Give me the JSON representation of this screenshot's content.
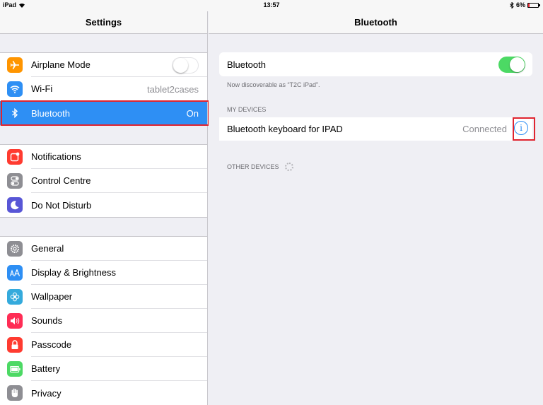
{
  "status_bar": {
    "device": "iPad",
    "time": "13:57",
    "battery": "6%"
  },
  "master": {
    "title": "Settings",
    "groups": [
      [
        {
          "label": "Airplane Mode",
          "icon": "airplane-icon",
          "color": "#ff9500"
        },
        {
          "label": "Wi-Fi",
          "value": "tablet2cases",
          "icon": "wifi-icon",
          "color": "#2e8ff4"
        },
        {
          "label": "Bluetooth",
          "value": "On",
          "icon": "bluetooth-icon",
          "color": "#2e8ff4"
        }
      ],
      [
        {
          "label": "Notifications",
          "icon": "notifications-icon",
          "color": "#ff3b30"
        },
        {
          "label": "Control Centre",
          "icon": "control-centre-icon",
          "color": "#8e8e93"
        },
        {
          "label": "Do Not Disturb",
          "icon": "moon-icon",
          "color": "#5856d6"
        }
      ],
      [
        {
          "label": "General",
          "icon": "gear-icon",
          "color": "#8e8e93"
        },
        {
          "label": "Display & Brightness",
          "icon": "text-size-icon",
          "color": "#2e8ff4"
        },
        {
          "label": "Wallpaper",
          "icon": "flower-icon",
          "color": "#34aadc"
        },
        {
          "label": "Sounds",
          "icon": "speaker-icon",
          "color": "#ff2d55"
        },
        {
          "label": "Passcode",
          "icon": "lock-icon",
          "color": "#ff3b30"
        },
        {
          "label": "Battery",
          "icon": "battery-icon",
          "color": "#4cd964"
        },
        {
          "label": "Privacy",
          "icon": "hand-icon",
          "color": "#8e8e93"
        }
      ]
    ]
  },
  "detail": {
    "title": "Bluetooth",
    "bluetooth_label": "Bluetooth",
    "discoverable": "Now discoverable as “T2C iPad”.",
    "my_devices_header": "MY DEVICES",
    "device": {
      "name": "Bluetooth keyboard for IPAD",
      "status": "Connected"
    },
    "other_devices_header": "OTHER DEVICES"
  },
  "colors": {
    "accent": "#2e8ff4",
    "toggle_on": "#4cd964",
    "highlight": "#e0242f"
  }
}
